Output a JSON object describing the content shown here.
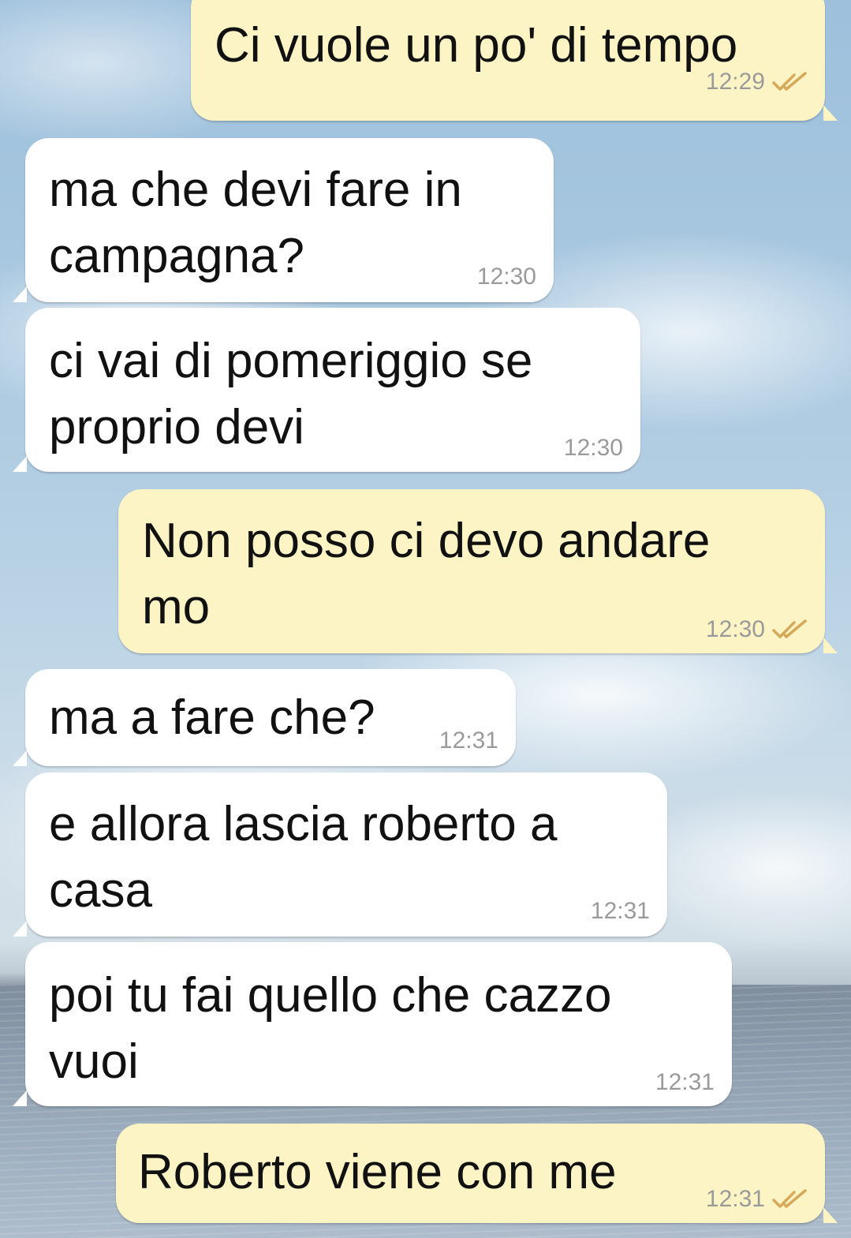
{
  "accent_colors": {
    "incoming_bubble": "#ffffff",
    "outgoing_bubble": "#fcf4c5",
    "timestamp": "#9a9a9a",
    "read_ticks": "#d6a85a"
  },
  "messages": [
    {
      "direction": "outgoing",
      "text": "Ci vuole un po' di tempo",
      "time": "12:29",
      "status_icon": "double-check-icon"
    },
    {
      "direction": "incoming",
      "text": "ma che devi fare in\ncampagna?",
      "time": "12:30"
    },
    {
      "direction": "incoming",
      "text": "ci vai di pomeriggio se\nproprio devi",
      "time": "12:30"
    },
    {
      "direction": "outgoing",
      "text": "Non posso ci devo andare\nmo",
      "time": "12:30",
      "status_icon": "double-check-icon"
    },
    {
      "direction": "incoming",
      "text": "ma a fare che?",
      "time": "12:31"
    },
    {
      "direction": "incoming",
      "text": "e allora lascia roberto a\ncasa",
      "time": "12:31"
    },
    {
      "direction": "incoming",
      "text": "poi tu fai quello che cazzo\nvuoi",
      "time": "12:31"
    },
    {
      "direction": "outgoing",
      "text": "Roberto viene con me",
      "time": "12:31",
      "status_icon": "double-check-icon"
    }
  ]
}
